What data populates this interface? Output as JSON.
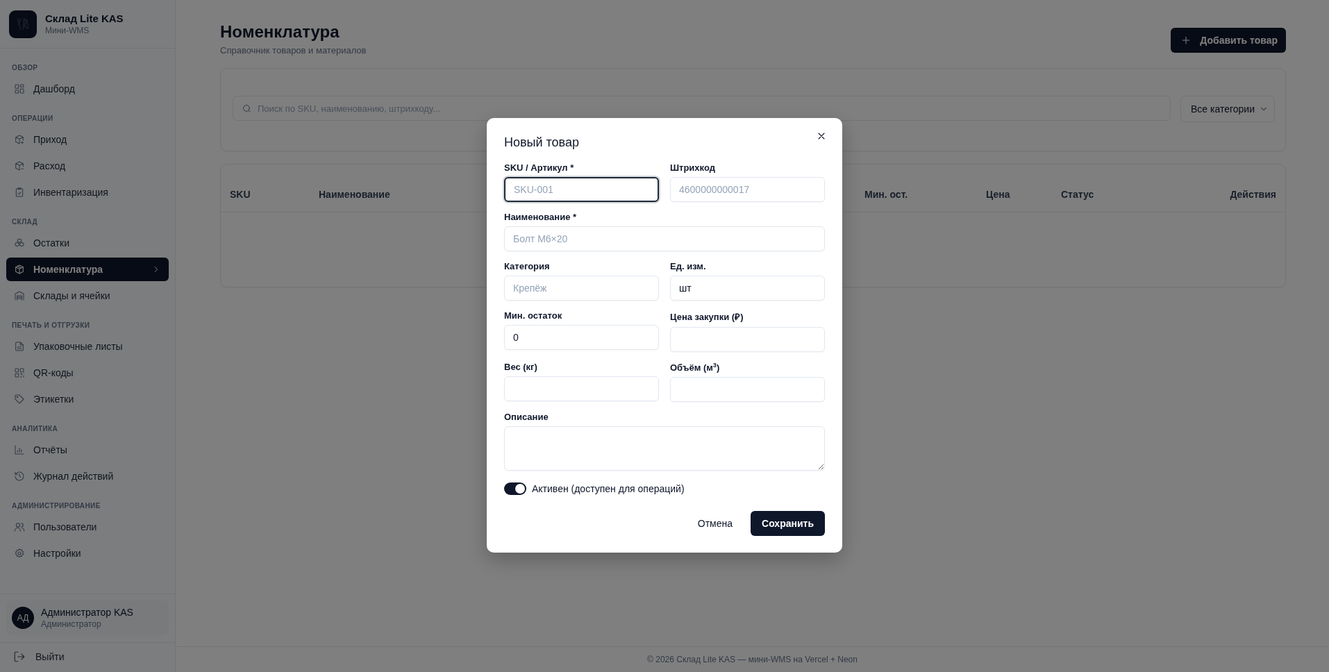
{
  "sidebar": {
    "brand": {
      "title": "Склад Lite KAS",
      "subtitle": "Мини-WMS"
    },
    "sections": [
      {
        "title": "ОБЗОР",
        "items": [
          {
            "label": "Дашборд",
            "selected": false
          }
        ]
      },
      {
        "title": "ОПЕРАЦИИ",
        "items": [
          {
            "label": "Приход",
            "selected": false
          },
          {
            "label": "Расход",
            "selected": false
          },
          {
            "label": "Инвентаризация",
            "selected": false
          }
        ]
      },
      {
        "title": "СКЛАД",
        "items": [
          {
            "label": "Остатки",
            "selected": false
          },
          {
            "label": "Номенклатура",
            "selected": true
          },
          {
            "label": "Склады и ячейки",
            "selected": false
          }
        ]
      },
      {
        "title": "ПЕЧАТЬ И ОТГРУЗКИ",
        "items": [
          {
            "label": "Упаковочные листы",
            "selected": false
          },
          {
            "label": "QR-коды",
            "selected": false
          },
          {
            "label": "Этикетки",
            "selected": false
          }
        ]
      },
      {
        "title": "АНАЛИТИКА",
        "items": [
          {
            "label": "Отчёты",
            "selected": false
          },
          {
            "label": "Журнал действий",
            "selected": false
          }
        ]
      },
      {
        "title": "АДМИНИСТРИРОВАНИЕ",
        "items": [
          {
            "label": "Пользователи",
            "selected": false
          },
          {
            "label": "Настройки",
            "selected": false
          }
        ]
      }
    ],
    "user": {
      "initials": "АД",
      "name": "Администратор KAS",
      "role": "Администратор"
    },
    "logout": "Выйти"
  },
  "page": {
    "title": "Номенклатура",
    "subtitle": "Справочник товаров и материалов",
    "add_button": "Добавить товар"
  },
  "filters": {
    "search": {
      "placeholder": "Поиск по SKU, наименованию, штрихкоду..."
    },
    "category": {
      "value": "Все категории"
    }
  },
  "table": {
    "columns": [
      "SKU",
      "Наименование",
      "Мин. ост.",
      "Цена",
      "Статус",
      "Действия"
    ]
  },
  "dialog": {
    "title": "Новый товар",
    "fields": [
      {
        "label": "SKU / Артикул *",
        "kind": "input",
        "placeholder": "SKU-001",
        "focused": true
      },
      {
        "label": "Штрихкод",
        "kind": "input",
        "placeholder": "4600000000017",
        "focused": false
      },
      {
        "label": "Наименование *",
        "kind": "wide",
        "placeholder": "Болт М6×20",
        "focused": false
      },
      {
        "label": "Категория",
        "kind": "input",
        "placeholder": "Крепёж",
        "focused": false
      },
      {
        "label": "Ед. изм.",
        "kind": "input",
        "value": "шт",
        "focused": false
      },
      {
        "label": "Мин. остаток",
        "kind": "input",
        "value": "0",
        "focused": false
      },
      {
        "label": "Цена закупки (₽)",
        "kind": "input",
        "focused": false
      },
      {
        "label": "Вес (кг)",
        "kind": "input",
        "focused": false
      },
      {
        "label": "Объём (м$^{3}$)",
        "kind": "input",
        "focused": false
      },
      {
        "label": "Описание",
        "kind": "textarea",
        "focused": false
      }
    ],
    "active": {
      "label": "Активен (доступен для операций)",
      "on": true
    },
    "cancel": "Отмена",
    "save": "Сохранить"
  },
  "footer": "© 2026 Склад Lite KAS — мини-WMS на Vercel + Neon"
}
